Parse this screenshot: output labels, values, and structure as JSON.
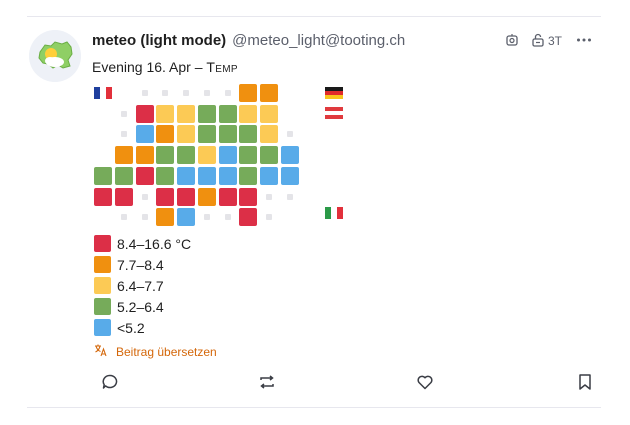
{
  "post": {
    "display_name": "meteo (light mode)",
    "handle": "@meteo_light@tooting.ch",
    "time": "3T",
    "subtitle_prefix": "Evening 16. Apr – ",
    "subtitle_caps": "Temp"
  },
  "meta_icons": [
    "bot-icon",
    "lock-open-icon",
    "more-icon"
  ],
  "colors": {
    "range1": "#dc2f47",
    "range2": "#f0900f",
    "range3": "#fcca55",
    "range4": "#76ab5a",
    "range5": "#58abe9",
    "empty": "#e4e4e8"
  },
  "map_grid": [
    "......22.",
    ".1334433.",
    ".5234443.",
    "224435445",
    "414555455",
    "1.11211..",
    "..25..1.."
  ],
  "legend": [
    {
      "label": "8.4–16.6 °C",
      "level": "1"
    },
    {
      "label": "7.7–8.4",
      "level": "2"
    },
    {
      "label": "6.4–7.7",
      "level": "3"
    },
    {
      "label": "5.2–6.4",
      "level": "4"
    },
    {
      "label": "<5.2",
      "level": "5"
    }
  ],
  "translate_label": "Beitrag übersetzen",
  "actions": [
    "reply-icon",
    "boost-icon",
    "favourite-icon",
    "bookmark-icon"
  ]
}
